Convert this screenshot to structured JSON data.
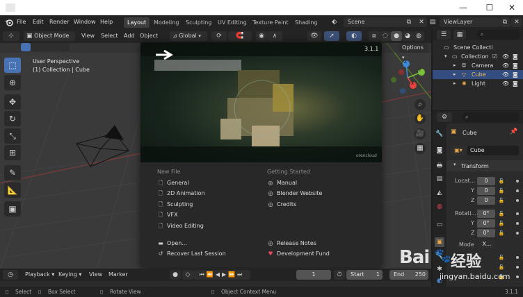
{
  "window": {
    "minimize_glyph": "—",
    "maximize_glyph": "☐",
    "close_glyph": "✕"
  },
  "menu": [
    "File",
    "Edit",
    "Render",
    "Window",
    "Help"
  ],
  "workspaces": [
    "Layout",
    "Modeling",
    "Sculpting",
    "UV Editing",
    "Texture Paint",
    "Shading"
  ],
  "scene_name": "Scene",
  "view_layer": "ViewLayer",
  "viewport_header": {
    "mode": "Object Mode",
    "menus": [
      "View",
      "Select",
      "Add",
      "Object"
    ],
    "orientation": "Global",
    "options": "Options"
  },
  "viewport_overlay": {
    "line1": "User Perspective",
    "line2": "(1) Collection | Cube"
  },
  "gizmo": {
    "x": "X",
    "y": "Y",
    "z": "Z"
  },
  "splash": {
    "version": "3.1.1",
    "credit": "orencloud",
    "new_file_heading": "New File",
    "new_file_items": [
      "General",
      "2D Animation",
      "Sculpting",
      "VFX",
      "Video Editing"
    ],
    "getting_started_heading": "Getting Started",
    "getting_started_items": [
      "Manual",
      "Blender Website",
      "Credits"
    ],
    "open": "Open...",
    "recover": "Recover Last Session",
    "release_notes": "Release Notes",
    "dev_fund": "Development Fund"
  },
  "timeline": {
    "playback": "Playback",
    "keying": "Keying",
    "view": "View",
    "marker": "Marker",
    "current_frame": "1",
    "start_label": "Start",
    "start_value": "1",
    "end_label": "End",
    "end_value": "250"
  },
  "statusbar": {
    "select": "Select",
    "box_select": "Box Select",
    "rotate_view": "Rotate View",
    "context_menu": "Object Context Menu",
    "version": "3.1.1"
  },
  "outliner": {
    "scene_collection": "Scene Collecti",
    "rows": [
      {
        "label": "Collection"
      },
      {
        "label": "Camera"
      },
      {
        "label": "Cube"
      },
      {
        "label": "Light"
      }
    ]
  },
  "properties": {
    "object_name": "Cube",
    "data_name": "Cube",
    "transform_heading": "Transform",
    "location_label": "Locat...",
    "rotation_label": "Rotati...",
    "mode_label": "Mode",
    "mode_value": "X...",
    "axis_x": "X",
    "axis_y": "Y",
    "axis_z": "Z",
    "location": [
      "0",
      "0",
      "0"
    ],
    "rotation": [
      "0°",
      "0°",
      "0°"
    ]
  },
  "watermark": {
    "brand_text": "Bai",
    "chinese": "经验",
    "site": "jingyan.baidu.com"
  },
  "colors": {
    "accent": "#4772b3",
    "selected_row": "#334d80",
    "active_tool": "#4772b3",
    "x_axis": "#e8433e",
    "y_axis": "#7bc23a",
    "z_axis": "#3e8bd6",
    "dev_fund_heart": "#e0485a"
  }
}
